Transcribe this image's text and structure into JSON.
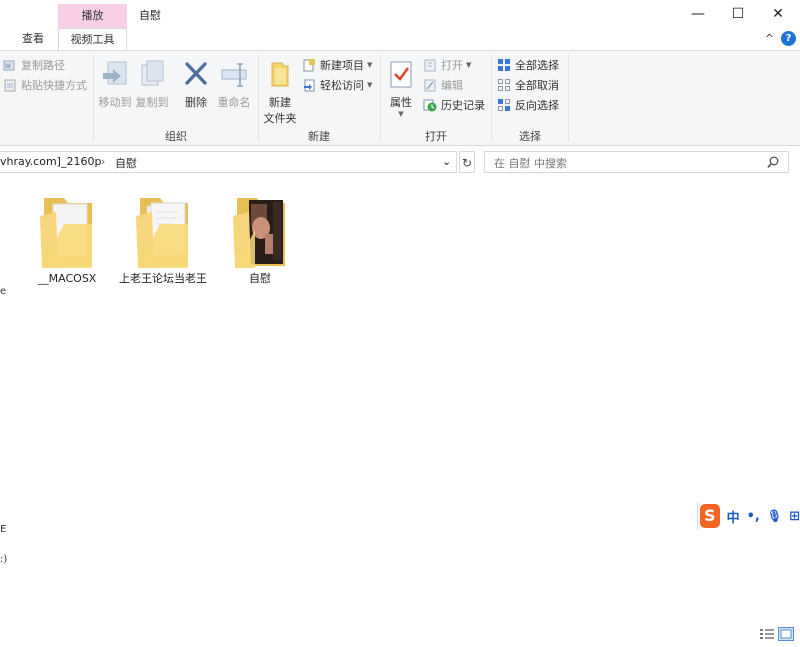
{
  "titlebar": {
    "context_tab": "播放",
    "title": "自慰",
    "minimize": "—",
    "maximize": "☐",
    "close": "✕"
  },
  "tabs": [
    {
      "label": "查看",
      "active": false
    },
    {
      "label": "视频工具",
      "active": true
    }
  ],
  "ribbon": {
    "collapse": "^",
    "help": "?",
    "clipboard": {
      "copy_path": "复制路径",
      "paste_shortcut": "粘贴快捷方式"
    },
    "organize": {
      "label": "组织",
      "move_to": "移动到",
      "copy_to": "复制到",
      "delete": "删除",
      "rename": "重命名"
    },
    "new": {
      "label": "新建",
      "new_item": "新建项目",
      "easy_access": "轻松访问",
      "new_folder_line1": "新建",
      "new_folder_line2": "文件夹"
    },
    "open": {
      "label": "打开",
      "properties": "属性",
      "open": "打开",
      "edit": "编辑",
      "history": "历史记录"
    },
    "select": {
      "label": "选择",
      "select_all": "全部选择",
      "select_none": "全部取消",
      "invert": "反向选择"
    }
  },
  "address": {
    "path_parent": "vhray.com]_2160p",
    "separator": "›",
    "path_current": "自慰",
    "dropdown": "⌄",
    "refresh": "↻",
    "search_placeholder": "在 自慰 中搜索"
  },
  "items": [
    {
      "label": "__MACOSX"
    },
    {
      "label": "上老王论坛当老王"
    },
    {
      "label": "自慰"
    }
  ],
  "ime": {
    "logo": "S",
    "mode": "中",
    "punct": "•,",
    "mic": "🎙",
    "more": "⊞"
  },
  "nav_edge": {
    "a": "e",
    "b": "E",
    "c": ":)"
  }
}
